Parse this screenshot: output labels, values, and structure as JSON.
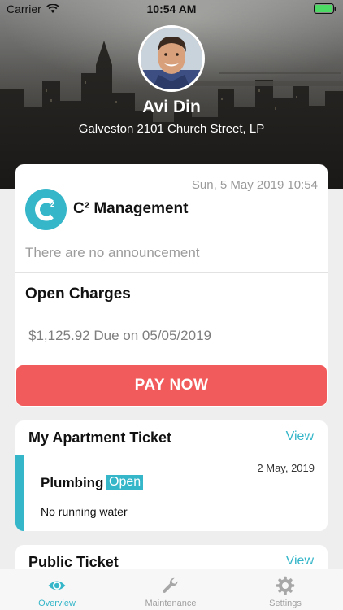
{
  "status_bar": {
    "carrier": "Carrier",
    "time": "10:54 AM"
  },
  "profile": {
    "name": "Avi Din",
    "address": "Galveston 2101 Church Street, LP"
  },
  "management_card": {
    "timestamp": "Sun, 5 May 2019 10:54",
    "company_name": "C² Management",
    "announcement_text": "There are no announcement",
    "charges_title": "Open Charges",
    "charges_text": "$1,125.92 Due on 05/05/2019"
  },
  "pay_button_label": "PAY NOW",
  "apartment_ticket": {
    "title": "My Apartment Ticket",
    "view_label": "View",
    "ticket": {
      "date": "2 May, 2019",
      "category": "Plumbing",
      "status": "Open",
      "description": "No running water"
    }
  },
  "public_ticket": {
    "title": "Public Ticket",
    "view_label": "View"
  },
  "tab_bar": {
    "tabs": [
      {
        "label": "Overview",
        "icon": "eye-icon",
        "active": true
      },
      {
        "label": "Maintenance",
        "icon": "wrench-icon",
        "active": false
      },
      {
        "label": "Settings",
        "icon": "gear-icon",
        "active": false
      }
    ]
  },
  "colors": {
    "accent": "#35b6c9",
    "pay_button": "#f25b5b",
    "background": "#eeeeee"
  }
}
